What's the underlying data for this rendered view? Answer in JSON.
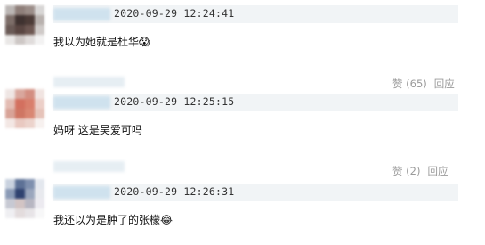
{
  "comments": [
    {
      "timestamp": "2020-09-29 12:24:41",
      "text": "我以为她就是杜华",
      "emoji": "😱"
    },
    {
      "timestamp": "2020-09-29 12:25:15",
      "text": "妈呀 这是吴爱可吗",
      "like_label": "赞 (65)",
      "reply_label": "回应"
    },
    {
      "timestamp": "2020-09-29 12:26:31",
      "text": "我还以为是肿了的张檬",
      "emoji": "😂",
      "like_label": "赞 (2)",
      "reply_label": "回应"
    }
  ]
}
